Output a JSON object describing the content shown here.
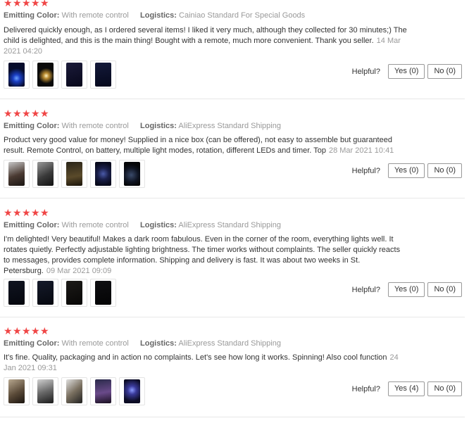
{
  "labels": {
    "color_key": "Emitting Color:",
    "logistics_key": "Logistics:",
    "helpful": "Helpful?"
  },
  "reviews": [
    {
      "stars": 5,
      "color": "With remote control",
      "logistics": "Cainiao Standard For Special Goods",
      "text": "Delivered quickly enough, as I ordered several items! I liked it very much, although they collected for 30 minutes;) The child is delighted, and this is the main thing! Bought with a remote, much more convenient. Thank you seller.",
      "date": "14 Mar 2021 04:20",
      "yes": "Yes (0)",
      "no": "No (0)",
      "photos": 4
    },
    {
      "stars": 5,
      "color": "With remote control",
      "logistics": "AliExpress Standard Shipping",
      "text": "Product very good value for money! Supplied in a nice box (can be offered), not easy to assemble but guaranteed result. Remote Control, on battery, multiple light modes, rotation, different LEDs and timer. Top",
      "date": "28 Mar 2021 10:41",
      "yes": "Yes (0)",
      "no": "No (0)",
      "photos": 5
    },
    {
      "stars": 5,
      "color": "With remote control",
      "logistics": "AliExpress Standard Shipping",
      "text": "I'm delighted! Very beautiful! Makes a dark room fabulous. Even in the corner of the room, everything lights well. It rotates quietly. Perfectly adjustable lighting brightness. The timer works without complaints. The seller quickly reacts to messages, provides complete information. Shipping and delivery is fast. It was about two weeks in St. Petersburg.",
      "date": "09 Mar 2021 09:09",
      "yes": "Yes (0)",
      "no": "No (0)",
      "photos": 4
    },
    {
      "stars": 5,
      "color": "With remote control",
      "logistics": "AliExpress Standard Shipping",
      "text": "It's fine. Quality, packaging and in action no complaints. Let's see how long it works. Spinning! Also cool function",
      "date": "24 Jan 2021 09:31",
      "yes": "Yes (4)",
      "no": "No (0)",
      "photos": 5
    }
  ],
  "colors": {
    "star": "#f04646",
    "muted": "#999999",
    "border": "#e8e8e8"
  }
}
